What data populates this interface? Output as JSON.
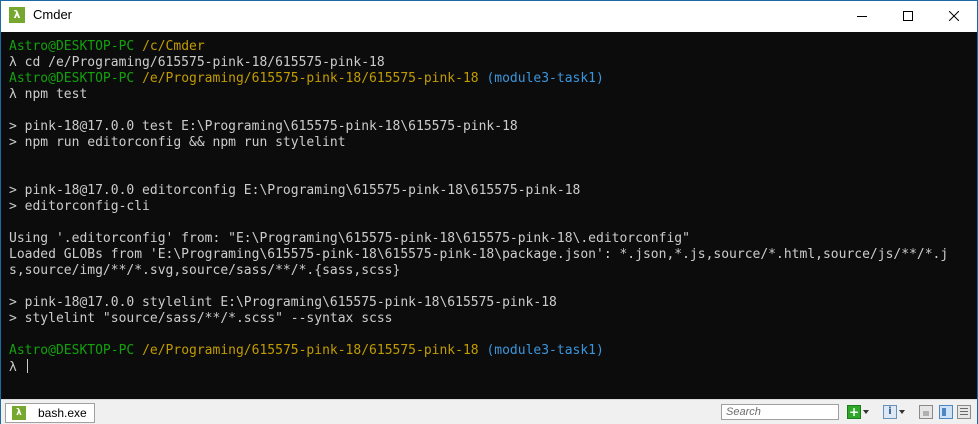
{
  "window": {
    "title": "Cmder",
    "app_icon": "lambda-icon",
    "controls": [
      "minimize-icon",
      "maximize-icon",
      "close-icon"
    ]
  },
  "terminal": {
    "colors": {
      "background": "#0c0c0c",
      "text": "#cccccc",
      "user_host": "#13a10e",
      "path": "#c19c00",
      "branch": "#3a96dd"
    },
    "lines": [
      [
        {
          "t": "Astro@DESKTOP-PC ",
          "c": "green"
        },
        {
          "t": "/c/Cmder",
          "c": "yellow"
        }
      ],
      [
        {
          "t": "λ cd /e/Programing/615575-pink-18/615575-pink-18",
          "c": ""
        }
      ],
      [
        {
          "t": "Astro@DESKTOP-PC ",
          "c": "green"
        },
        {
          "t": "/e/Programing/615575-pink-18/615575-pink-18 ",
          "c": "yellow"
        },
        {
          "t": "(module3-task1)",
          "c": "cyan"
        }
      ],
      [
        {
          "t": "λ npm test",
          "c": ""
        }
      ],
      [
        {
          "t": "",
          "c": ""
        }
      ],
      [
        {
          "t": "> pink-18@17.0.0 test E:\\Programing\\615575-pink-18\\615575-pink-18",
          "c": ""
        }
      ],
      [
        {
          "t": "> npm run editorconfig && npm run stylelint",
          "c": ""
        }
      ],
      [
        {
          "t": "",
          "c": ""
        }
      ],
      [
        {
          "t": "",
          "c": ""
        }
      ],
      [
        {
          "t": "> pink-18@17.0.0 editorconfig E:\\Programing\\615575-pink-18\\615575-pink-18",
          "c": ""
        }
      ],
      [
        {
          "t": "> editorconfig-cli",
          "c": ""
        }
      ],
      [
        {
          "t": "",
          "c": ""
        }
      ],
      [
        {
          "t": "Using '.editorconfig' from: \"E:\\Programing\\615575-pink-18\\615575-pink-18\\.editorconfig\"",
          "c": ""
        }
      ],
      [
        {
          "t": "Loaded GLOBs from 'E:\\Programing\\615575-pink-18\\615575-pink-18\\package.json': *.json,*.js,source/*.html,source/js/**/*.j",
          "c": ""
        }
      ],
      [
        {
          "t": "s,source/img/**/*.svg,source/sass/**/*.{sass,scss}",
          "c": ""
        }
      ],
      [
        {
          "t": "",
          "c": ""
        }
      ],
      [
        {
          "t": "> pink-18@17.0.0 stylelint E:\\Programing\\615575-pink-18\\615575-pink-18",
          "c": ""
        }
      ],
      [
        {
          "t": "> stylelint \"source/sass/**/*.scss\" --syntax scss",
          "c": ""
        }
      ],
      [
        {
          "t": "",
          "c": ""
        }
      ],
      [
        {
          "t": "Astro@DESKTOP-PC ",
          "c": "green"
        },
        {
          "t": "/e/Programing/615575-pink-18/615575-pink-18 ",
          "c": "yellow"
        },
        {
          "t": "(module3-task1)",
          "c": "cyan"
        }
      ],
      [
        {
          "t": "λ ",
          "c": ""
        }
      ]
    ]
  },
  "statusbar": {
    "tab_label": "bash.exe",
    "tab_icon": "lambda-icon",
    "search_placeholder": "Search",
    "icons": [
      "add-console-icon",
      "info-icon",
      "lock-icon",
      "split-view-icon",
      "menu-icon"
    ]
  }
}
